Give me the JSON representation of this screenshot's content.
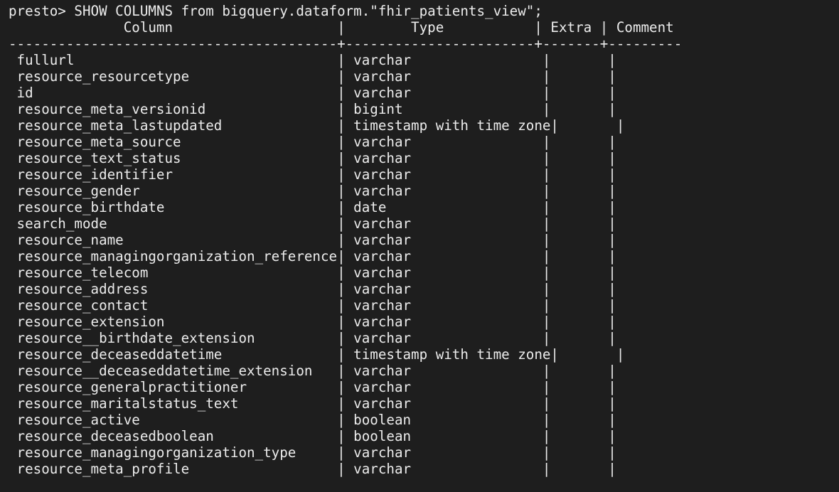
{
  "terminal": {
    "prompt": "presto> ",
    "command": "SHOW COLUMNS from bigquery.dataform.\"fhir_patients_view\";",
    "header": "              Column                    |        Type           | Extra | Comment ",
    "separator": "----------------------------------------+-----------------------+-------+---------",
    "rows": [
      {
        "column": "fullurl",
        "type": "varchar"
      },
      {
        "column": "resource_resourcetype",
        "type": "varchar"
      },
      {
        "column": "id",
        "type": "varchar"
      },
      {
        "column": "resource_meta_versionid",
        "type": "bigint"
      },
      {
        "column": "resource_meta_lastupdated",
        "type": "timestamp with time zone"
      },
      {
        "column": "resource_meta_source",
        "type": "varchar"
      },
      {
        "column": "resource_text_status",
        "type": "varchar"
      },
      {
        "column": "resource_identifier",
        "type": "varchar"
      },
      {
        "column": "resource_gender",
        "type": "varchar"
      },
      {
        "column": "resource_birthdate",
        "type": "date"
      },
      {
        "column": "search_mode",
        "type": "varchar"
      },
      {
        "column": "resource_name",
        "type": "varchar"
      },
      {
        "column": "resource_managingorganization_reference",
        "type": "varchar"
      },
      {
        "column": "resource_telecom",
        "type": "varchar"
      },
      {
        "column": "resource_address",
        "type": "varchar"
      },
      {
        "column": "resource_contact",
        "type": "varchar"
      },
      {
        "column": "resource_extension",
        "type": "varchar"
      },
      {
        "column": "resource__birthdate_extension",
        "type": "varchar"
      },
      {
        "column": "resource_deceaseddatetime",
        "type": "timestamp with time zone"
      },
      {
        "column": "resource__deceaseddatetime_extension",
        "type": "varchar"
      },
      {
        "column": "resource_generalpractitioner",
        "type": "varchar"
      },
      {
        "column": "resource_maritalstatus_text",
        "type": "varchar"
      },
      {
        "column": "resource_active",
        "type": "boolean"
      },
      {
        "column": "resource_deceasedboolean",
        "type": "boolean"
      },
      {
        "column": "resource_managingorganization_type",
        "type": "varchar"
      },
      {
        "column": "resource_meta_profile",
        "type": "varchar"
      }
    ]
  }
}
